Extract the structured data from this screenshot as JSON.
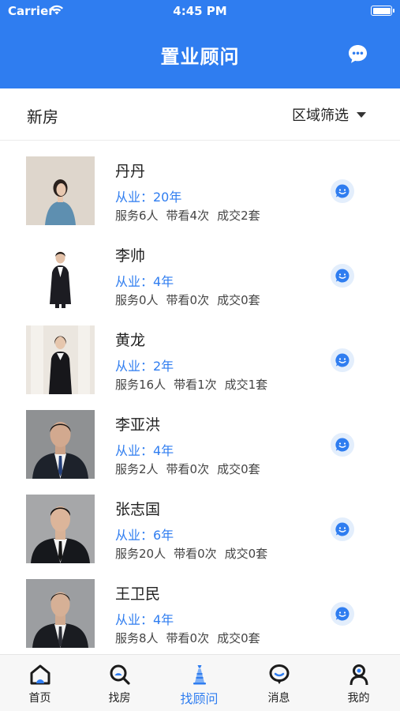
{
  "status_bar": {
    "carrier": "Carrier",
    "time": "4:45 PM"
  },
  "header": {
    "title": "置业顾问"
  },
  "filter": {
    "title": "新房",
    "region_label": "区域筛选"
  },
  "consultants": [
    {
      "name": "丹丹",
      "experience": "从业：20年",
      "served": "服务6人",
      "viewings": "带看4次",
      "deals": "成交2套"
    },
    {
      "name": "李帅",
      "experience": "从业：4年",
      "served": "服务0人",
      "viewings": "带看0次",
      "deals": "成交0套"
    },
    {
      "name": "黄龙",
      "experience": "从业：2年",
      "served": "服务16人",
      "viewings": "带看1次",
      "deals": "成交1套"
    },
    {
      "name": "李亚洪",
      "experience": "从业：4年",
      "served": "服务2人",
      "viewings": "带看0次",
      "deals": "成交0套"
    },
    {
      "name": "张志国",
      "experience": "从业：6年",
      "served": "服务20人",
      "viewings": "带看0次",
      "deals": "成交0套"
    },
    {
      "name": "王卫民",
      "experience": "从业：4年",
      "served": "服务8人",
      "viewings": "带看0次",
      "deals": "成交0套"
    }
  ],
  "tabs": [
    {
      "label": "首页",
      "icon": "home-icon"
    },
    {
      "label": "找房",
      "icon": "search-icon"
    },
    {
      "label": "找顾问",
      "icon": "consultant-icon",
      "active": true
    },
    {
      "label": "消息",
      "icon": "message-icon"
    },
    {
      "label": "我的",
      "icon": "profile-icon"
    }
  ],
  "colors": {
    "primary": "#2f7df0",
    "text": "#222222",
    "secondary_text": "#444444"
  }
}
